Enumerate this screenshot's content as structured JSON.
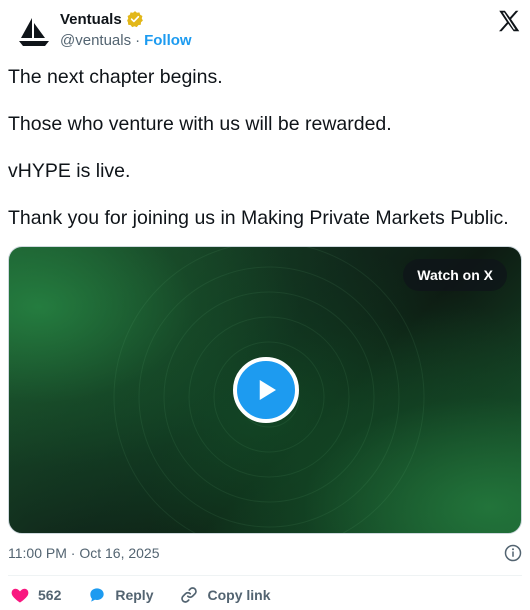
{
  "author": {
    "display_name": "Ventuals",
    "handle": "@ventuals",
    "separator": "·",
    "follow_label": "Follow",
    "verified_color": "#e2b719"
  },
  "tweet": {
    "lines": [
      "The next chapter begins.",
      "Those who venture with us will be rewarded.",
      "vHYPE is live.",
      "Thank you for joining us in Making Private Markets Public."
    ]
  },
  "media": {
    "watch_label": "Watch on X",
    "play_color": "#1d9bf0"
  },
  "meta": {
    "timestamp": "11:00 PM · Oct 16, 2025"
  },
  "actions": {
    "like_count": "562",
    "reply_label": "Reply",
    "copy_label": "Copy link",
    "like_color": "#f91880",
    "accent": "#1d9bf0"
  },
  "icons": [
    "sailboat-logo-icon",
    "verified-badge-icon",
    "x-logo-icon",
    "play-icon",
    "info-icon",
    "heart-icon",
    "reply-bubble-icon",
    "link-icon"
  ]
}
